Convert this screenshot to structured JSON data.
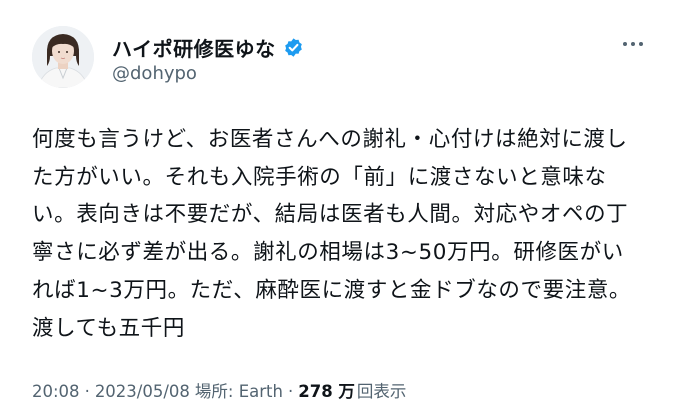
{
  "author": {
    "display_name": "ハイポ研修医ゆな",
    "handle": "@dohypo",
    "verified": true,
    "verified_color": "#1d9bf0"
  },
  "icons": {
    "avatar": "profile-photo",
    "verified": "verified-badge-icon",
    "more": "more-options-icon"
  },
  "tweet": {
    "lines": [
      "何度も言うけど、お医者さんへの謝礼・心付けは絶対に渡し",
      "た方がいい。それも入院手術の「前」に渡さないと意味な",
      "い。表向きは不要だが、結局は医者も人間。対応やオペの丁",
      "寧さに必ず差が出る。謝礼の相場は3~50万円。研修医がい",
      "れば1~3万円。ただ、麻酔医に渡すと金ドブなので要注意。",
      "渡しても五千円"
    ]
  },
  "meta": {
    "time": "20:08",
    "separator": "·",
    "date": "2023/05/08",
    "location": "場所: Earth",
    "views_count": "278 万",
    "views_label": "回表示"
  },
  "colors": {
    "text_primary": "#0f1419",
    "text_secondary": "#536471"
  }
}
